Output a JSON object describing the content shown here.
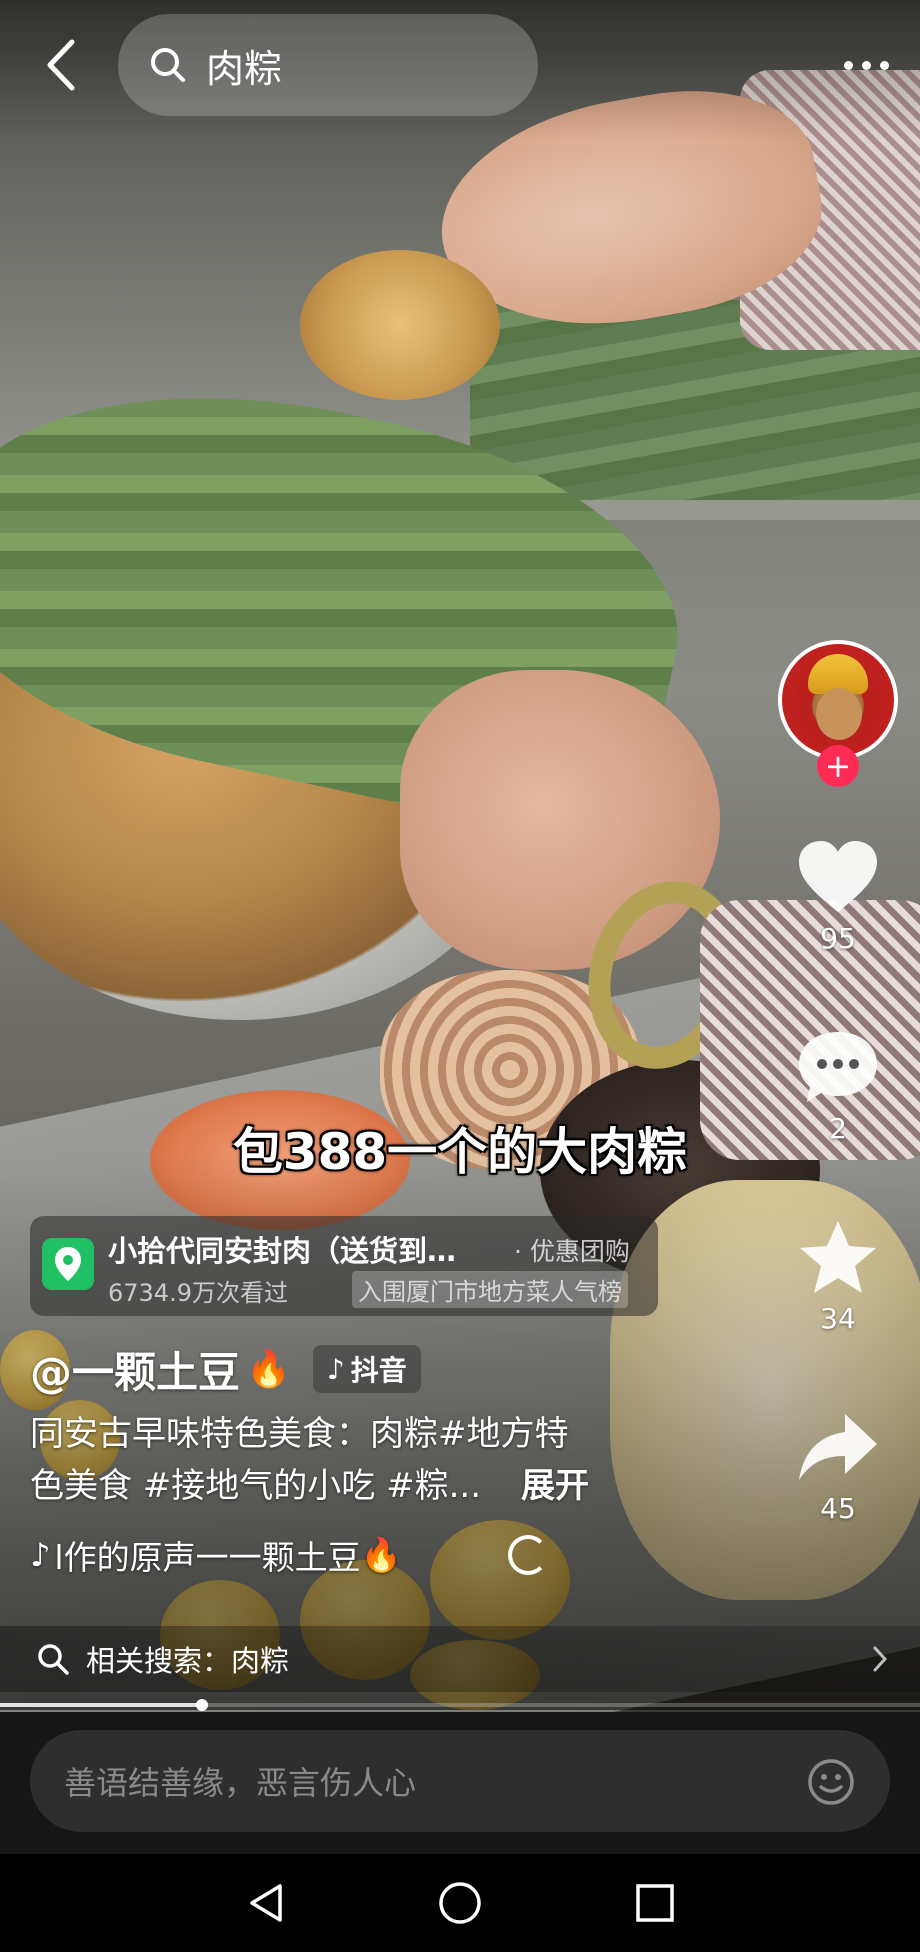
{
  "search": {
    "query": "肉粽"
  },
  "video": {
    "subtitle": "包388一个的大肉粽",
    "progress": 0.22
  },
  "rail": {
    "likes": "95",
    "comments": "2",
    "favorites": "34",
    "shares": "45",
    "follow_symbol": "+"
  },
  "poi": {
    "title": "小拾代同安封肉（送货到…",
    "tag": "· 优惠团购",
    "views": "6734.9万次看过",
    "rank": "入围厦门市地方菜人气榜"
  },
  "author": {
    "name": "@一颗土豆",
    "fire": "🔥",
    "badge": "抖音",
    "badge_icon": "♪"
  },
  "caption": {
    "line1": "同安古早味特色美食：肉粽#地方特",
    "line2": "色美食 #接地气的小吃 #粽...",
    "expand": "展开"
  },
  "music": {
    "icon": "♪",
    "text": "l作的原声一一颗土豆",
    "fire": "🔥"
  },
  "related": {
    "label": "相关搜索：肉粽"
  },
  "comment": {
    "placeholder": "善语结善缘，恶言伤人心"
  },
  "icons": {
    "back": "back-arrow-icon",
    "search": "search-icon",
    "more": "more-dots-icon",
    "like": "heart-icon",
    "comment": "chat-bubble-icon",
    "favorite": "star-icon",
    "share": "share-arrow-icon",
    "location": "location-pin-icon",
    "emoji": "smiley-icon",
    "nav_back": "triangle-back-icon",
    "nav_home": "circle-home-icon",
    "nav_recents": "square-recents-icon"
  },
  "colors": {
    "accent": "#fe2c55",
    "poi_green": "#21c064",
    "comment_bg": "#161616"
  }
}
